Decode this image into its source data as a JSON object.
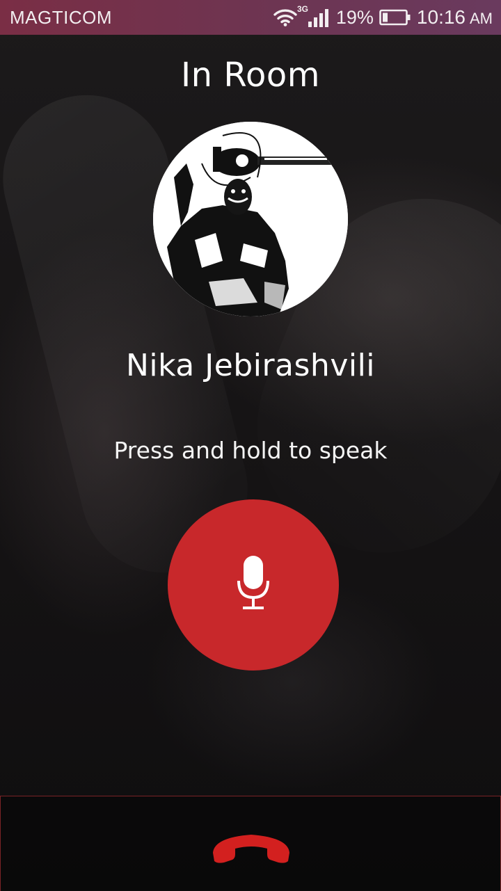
{
  "status_bar": {
    "carrier": "MAGTICOM",
    "network_type": "3G",
    "battery_percent": "19%",
    "time": "10:16",
    "ampm": "AM",
    "icons": [
      "wifi-icon",
      "signal-icon",
      "battery-icon"
    ]
  },
  "screen": {
    "title": "In Room",
    "contact_name": "Nika Jebirashvili",
    "hint": "Press and hold to speak"
  },
  "controls": {
    "talk_icon": "microphone-icon",
    "hangup_icon": "hang-up-phone-icon"
  },
  "colors": {
    "status_bar": "#7a2e45",
    "talk_button": "#c8282b",
    "hangup": "#d3201f",
    "bottom_border": "#7a2326"
  }
}
